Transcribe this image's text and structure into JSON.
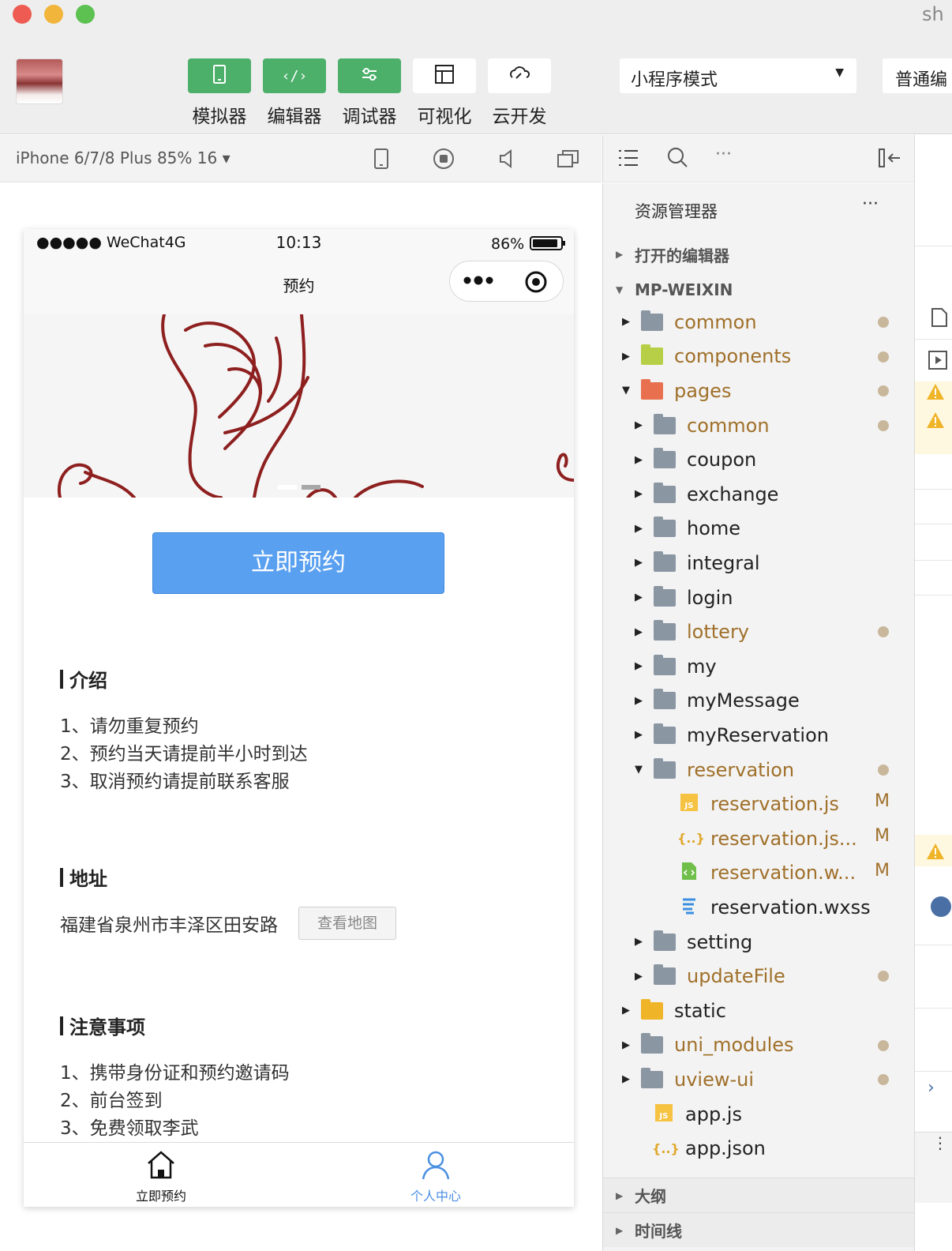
{
  "window": {
    "title_fragment": "sh"
  },
  "toolbar": {
    "buttons": [
      {
        "label": "模拟器",
        "icon": "phone-icon"
      },
      {
        "label": "编辑器",
        "icon": "code-icon"
      },
      {
        "label": "调试器",
        "icon": "debug-sliders-icon"
      },
      {
        "label": "可视化",
        "icon": "layout-icon"
      },
      {
        "label": "云开发",
        "icon": "cloud-link-icon"
      }
    ],
    "mode_select": "小程序模式",
    "compile_select": "普通编"
  },
  "simulator": {
    "device": "iPhone 6/7/8 Plus 85% 16 ▾",
    "statusbar": {
      "carrier": "●●●●● WeChat4G",
      "time": "10:13",
      "battery": "86%"
    },
    "nav_title": "预约",
    "reserve_button": "立即预约",
    "sections": {
      "intro_title": "介绍",
      "intro_lines": [
        "1、请勿重复预约",
        "2、预约当天请提前半小时到达",
        "3、取消预约请提前联系客服"
      ],
      "address_title": "地址",
      "address_text": "福建省泉州市丰泽区田安路",
      "map_button": "查看地图",
      "notice_title": "注意事项",
      "notice_lines": [
        "1、携带身份证和预约邀请码",
        "2、前台签到",
        "3、免费领取李武"
      ]
    },
    "tabbar": {
      "tab1": "立即预约",
      "tab2": "个人中心"
    }
  },
  "explorer": {
    "title": "资源管理器",
    "more": "···",
    "open_editors": "打开的编辑器",
    "project": "MP-WEIXIN",
    "tree": [
      {
        "name": "common",
        "color": "#a0702a",
        "modified": "dot"
      },
      {
        "name": "components",
        "color": "#a0702a",
        "modified": "dot"
      },
      {
        "name": "pages",
        "color": "#a0702a",
        "modified": "dot"
      },
      {
        "name": "common",
        "color": "#a0702a",
        "modified": "dot"
      },
      {
        "name": "coupon",
        "color": "#222222",
        "modified": ""
      },
      {
        "name": "exchange",
        "color": "#222222",
        "modified": ""
      },
      {
        "name": "home",
        "color": "#222222",
        "modified": ""
      },
      {
        "name": "integral",
        "color": "#222222",
        "modified": ""
      },
      {
        "name": "login",
        "color": "#222222",
        "modified": ""
      },
      {
        "name": "lottery",
        "color": "#a0702a",
        "modified": "dot"
      },
      {
        "name": "my",
        "color": "#222222",
        "modified": ""
      },
      {
        "name": "myMessage",
        "color": "#222222",
        "modified": ""
      },
      {
        "name": "myReservation",
        "color": "#222222",
        "modified": ""
      },
      {
        "name": "reservation",
        "color": "#a0702a",
        "modified": "dot"
      },
      {
        "name": "reservation.js",
        "color": "#a0702a",
        "modified": "M"
      },
      {
        "name": "reservation.js...",
        "color": "#a0702a",
        "modified": "M"
      },
      {
        "name": "reservation.w...",
        "color": "#a0702a",
        "modified": "M"
      },
      {
        "name": "reservation.wxss",
        "color": "#222222",
        "modified": ""
      },
      {
        "name": "setting",
        "color": "#222222",
        "modified": ""
      },
      {
        "name": "updateFile",
        "color": "#a0702a",
        "modified": "dot"
      },
      {
        "name": "static",
        "color": "#222222",
        "modified": ""
      },
      {
        "name": "uni_modules",
        "color": "#a0702a",
        "modified": "dot"
      },
      {
        "name": "uview-ui",
        "color": "#a0702a",
        "modified": "dot"
      },
      {
        "name": "app.js",
        "color": "#222222",
        "modified": ""
      },
      {
        "name": "app.json",
        "color": "#222222",
        "modified": ""
      }
    ],
    "outline": "大纲",
    "timeline": "时间线"
  },
  "colors": {
    "accent_green": "#4caf6a",
    "button_blue": "#5aa0f0",
    "modified": "#a0702a",
    "tab_active": "#4a90e2"
  }
}
